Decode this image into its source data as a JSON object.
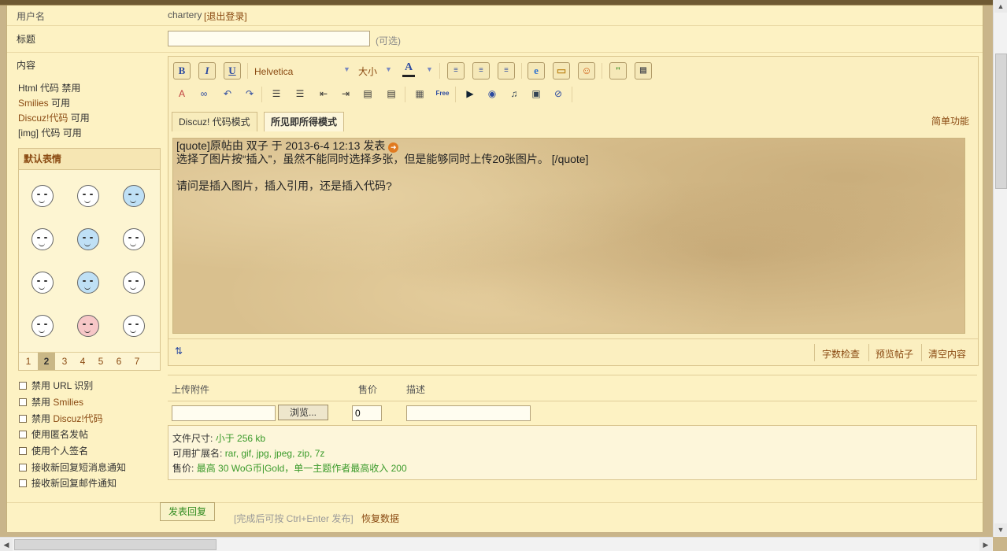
{
  "form": {
    "username_label": "用户名",
    "username": "chartery",
    "logout_link": "[退出登录]",
    "title_label": "标题",
    "title_value": "",
    "title_hint": "(可选)",
    "content_label": "内容",
    "permissions": [
      {
        "name": "Html 代码",
        "state": "禁用"
      },
      {
        "name": "Smilies",
        "state": "可用"
      },
      {
        "name": "Discuz!代码",
        "state": "可用"
      },
      {
        "name": "[img] 代码",
        "state": "可用"
      }
    ]
  },
  "toolbar": {
    "font_select": "Helvetica",
    "size_select": "大小",
    "bold_icon": "B",
    "italic_icon": "I",
    "underline_icon": "U",
    "color_icon": "A",
    "free_icon": "Free"
  },
  "editor": {
    "tab_code": "Discuz! 代码模式",
    "tab_wysiwyg": "所见即所得模式",
    "simple_mode": "简单功能",
    "content_lines": [
      "[quote]原帖由  双子 于 2013-6-4 12:13 发表",
      "选择了图片按“插入”，虽然不能同时选择多张，但是能够同时上传20张图片。 [/quote]",
      "",
      "请问是插入图片，插入引用，还是插入代码?"
    ],
    "word_check": "字数检查",
    "preview": "预览帖子",
    "clear": "清空内容"
  },
  "smilies": {
    "title": "默认表情",
    "pages": [
      "1",
      "2",
      "3",
      "4",
      "5",
      "6",
      "7"
    ],
    "active_page": "2"
  },
  "options": [
    {
      "prefix": "禁用 URL 识别",
      "highlight": ""
    },
    {
      "prefix": "禁用 ",
      "highlight": "Smilies"
    },
    {
      "prefix": "禁用 ",
      "highlight": "Discuz!代码"
    },
    {
      "prefix": "使用匿名发帖",
      "highlight": ""
    },
    {
      "prefix": "使用个人签名",
      "highlight": ""
    },
    {
      "prefix": "接收新回复短消息通知",
      "highlight": ""
    },
    {
      "prefix": "接收新回复邮件通知",
      "highlight": ""
    }
  ],
  "attachment": {
    "upload_label": "上传附件",
    "price_label": "售价",
    "desc_label": "描述",
    "browse_button": "浏览...",
    "price_value": "0",
    "size_label": "文件尺寸:",
    "size_value": "小于 256 kb",
    "ext_label": "可用扩展名:",
    "ext_value": "rar, gif, jpg, jpeg, zip, 7z",
    "sale_label": "售价:",
    "sale_value": "最高 30 WoG币|Gold，单一主题作者最高收入 200"
  },
  "submit": {
    "button": "发表回复",
    "hint": "[完成后可按 Ctrl+Enter 发布]",
    "restore": "恢复数据"
  },
  "colors": {
    "background": "#fdf2c3",
    "link_brown": "#8a4a12",
    "accent_green": "#3a9a2a"
  }
}
